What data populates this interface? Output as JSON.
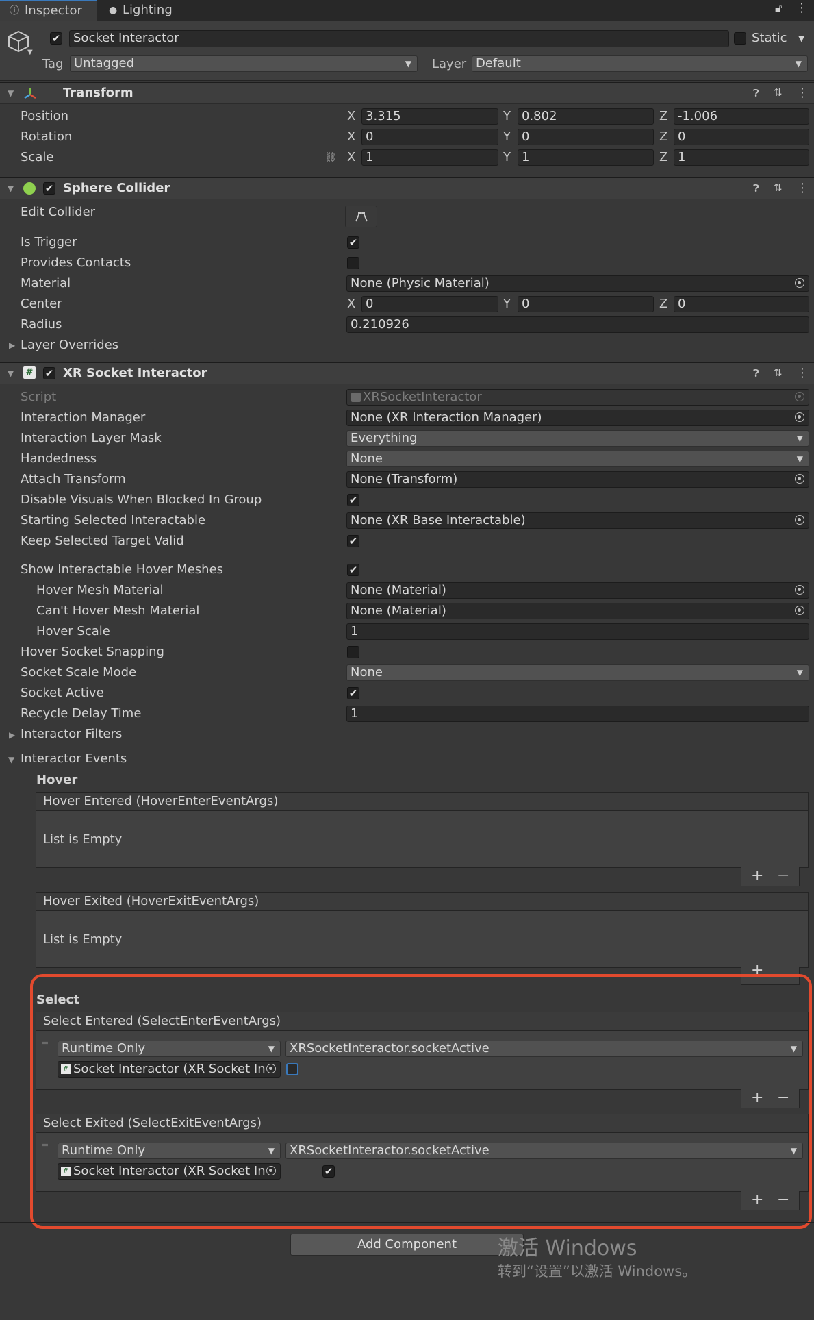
{
  "tabs": [
    "Inspector",
    "Lighting"
  ],
  "object": {
    "name": "Socket Interactor",
    "static_label": "Static",
    "tag_label": "Tag",
    "tag_value": "Untagged",
    "layer_label": "Layer",
    "layer_value": "Default"
  },
  "transform": {
    "title": "Transform",
    "position": {
      "label": "Position",
      "x": "3.315",
      "y": "0.802",
      "z": "-1.006"
    },
    "rotation": {
      "label": "Rotation",
      "x": "0",
      "y": "0",
      "z": "0"
    },
    "scale": {
      "label": "Scale",
      "x": "1",
      "y": "1",
      "z": "1"
    }
  },
  "axes": {
    "x": "X",
    "y": "Y",
    "z": "Z"
  },
  "sphere": {
    "title": "Sphere Collider",
    "edit_collider": "Edit Collider",
    "is_trigger": "Is Trigger",
    "provides_contacts": "Provides Contacts",
    "material_label": "Material",
    "material_value": "None (Physic Material)",
    "center_label": "Center",
    "center_x": "0",
    "center_y": "0",
    "center_z": "0",
    "radius_label": "Radius",
    "radius_value": "0.210926",
    "layer_overrides": "Layer Overrides"
  },
  "xr": {
    "title": "XR Socket Interactor",
    "script_label": "Script",
    "script_value": "XRSocketInteractor",
    "im_label": "Interaction Manager",
    "im_value": "None (XR Interaction Manager)",
    "ilm_label": "Interaction Layer Mask",
    "ilm_value": "Everything",
    "hand_label": "Handedness",
    "hand_value": "None",
    "attach_label": "Attach Transform",
    "attach_value": "None (Transform)",
    "dv_label": "Disable Visuals When Blocked In Group",
    "ssi_label": "Starting Selected Interactable",
    "ssi_value": "None (XR Base Interactable)",
    "kstv_label": "Keep Selected Target Valid",
    "sihm_label": "Show Interactable Hover Meshes",
    "hmm_label": "Hover Mesh Material",
    "hmm_value": "None (Material)",
    "chmm_label": "Can't Hover Mesh Material",
    "chmm_value": "None (Material)",
    "hs_label": "Hover Scale",
    "hs_value": "1",
    "hss_label": "Hover Socket Snapping",
    "ssm_label": "Socket Scale Mode",
    "ssm_value": "None",
    "sa_label": "Socket Active",
    "rdt_label": "Recycle Delay Time",
    "rdt_value": "1",
    "filters": "Interactor Filters",
    "events": "Interactor Events"
  },
  "hover": {
    "title": "Hover",
    "entered": "Hover Entered (HoverEnterEventArgs)",
    "exited": "Hover Exited (HoverExitEventArgs)",
    "empty": "List is Empty"
  },
  "select": {
    "title": "Select",
    "entered": "Select Entered (SelectEnterEventArgs)",
    "exited": "Select Exited (SelectExitEventArgs)",
    "runtime": "Runtime Only",
    "function": "XRSocketInteractor.socketActive",
    "target": "Socket Interactor (XR Socket In"
  },
  "buttons": {
    "plus": "+",
    "minus": "−",
    "add_component": "Add Component"
  },
  "watermark": {
    "line1": "激活 Windows",
    "line2": "转到“设置”以激活 Windows。"
  },
  "colors": {
    "background": "#383838",
    "accent": "#3a79bb",
    "highlight": "#e24a2e"
  }
}
